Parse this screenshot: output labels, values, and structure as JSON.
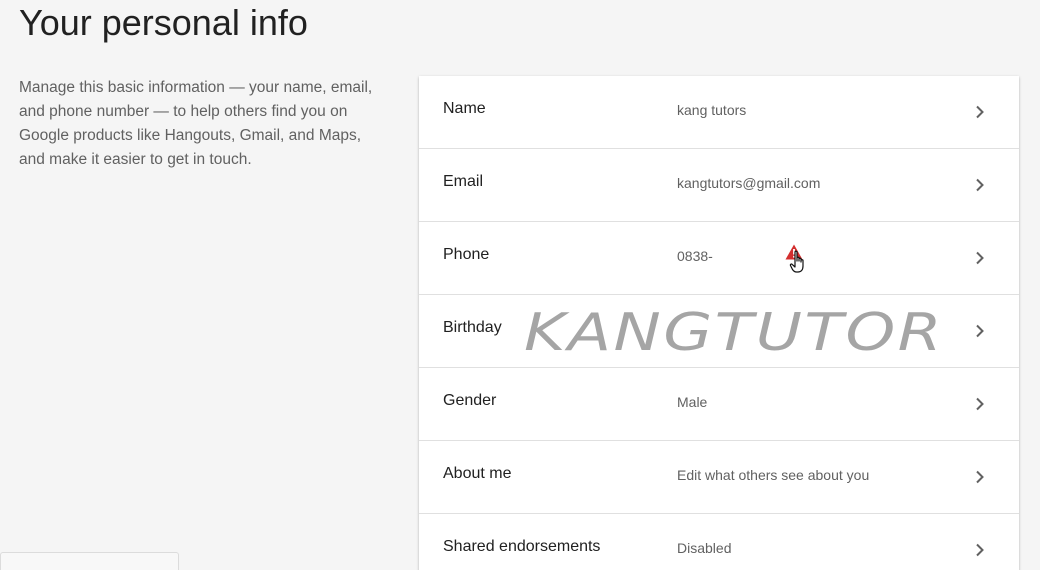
{
  "page": {
    "title": "Your personal info",
    "description": "Manage this basic information — your name, email, and phone number — to help others find you on Google products like Hangouts, Gmail, and Maps, and make it easier to get in touch."
  },
  "rows": [
    {
      "label": "Name",
      "value": "kang tutors"
    },
    {
      "label": "Email",
      "value": "kangtutors@gmail.com"
    },
    {
      "label": "Phone",
      "value": "0838-"
    },
    {
      "label": "Birthday",
      "value": ""
    },
    {
      "label": "Gender",
      "value": "Male"
    },
    {
      "label": "About me",
      "value": "Edit what others see about you"
    },
    {
      "label": "Shared endorsements",
      "value": "Disabled"
    }
  ],
  "watermark": {
    "text": "KANGTUTOR"
  },
  "icons": {
    "chevron": "chevron-right-icon",
    "warning": "warning-icon",
    "cursor": "hand-cursor-icon"
  },
  "colors": {
    "warning": "#d32f2f",
    "watermark": "#9e9e9e"
  }
}
